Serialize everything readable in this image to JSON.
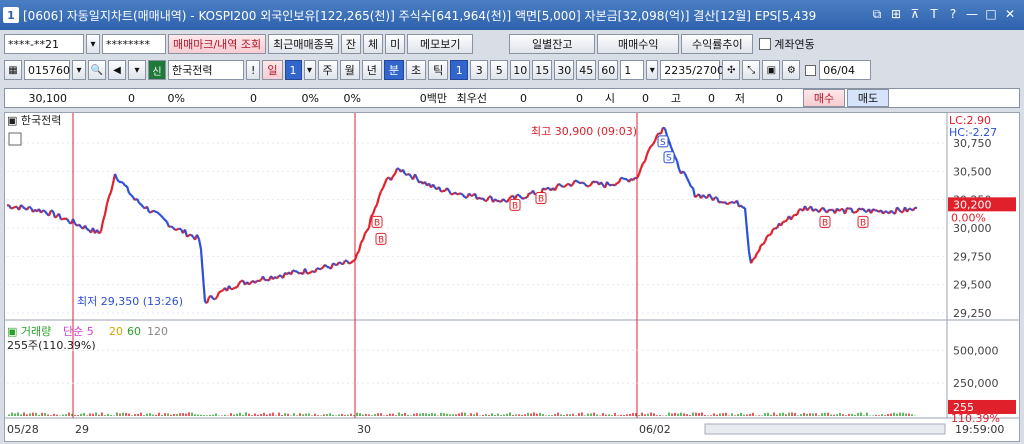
{
  "window": {
    "num": "1",
    "title": "[0606] 자동일지차트(매매내역) - KOSPI200 외국인보유[122,265(천)] 주식수[641,964(천)] 액면[5,000] 자본금[32,098(억)] 결산[12월] EPS[5,439"
  },
  "toolbar1": {
    "account": "****-**21",
    "password": "********",
    "btn_query": "매매마크/내역 조회",
    "btn_recent": "최근매매종목",
    "btn_jan": "잔",
    "btn_che": "체",
    "btn_mi": "미",
    "btn_memo": "메모보기",
    "btn_daily": "일별잔고",
    "btn_profit": "매매수익",
    "btn_ratio": "수익률추이",
    "chk_account": "계좌연동"
  },
  "toolbar2": {
    "code": "015760",
    "badge": "신",
    "name": "한국전력",
    "excl": "!",
    "period_il": "일",
    "period_num": "1",
    "ju": "주",
    "wol": "월",
    "nyeon": "년",
    "bun": "분",
    "cho": "초",
    "tik": "틱",
    "intervals": [
      "1",
      "3",
      "5",
      "10",
      "15",
      "30",
      "45",
      "60"
    ],
    "count": "1",
    "range": "2235/2700",
    "date": "06/04"
  },
  "statusbar": {
    "price": "30,100",
    "v1": "0",
    "p1": "0%",
    "v2": "0",
    "p2": "0%",
    "p3": "0%",
    "unit": "0백만",
    "best": "최우선",
    "b1": "0",
    "b2": "0",
    "si": "시",
    "si_v": "0",
    "go": "고",
    "go_v": "0",
    "jeo": "저",
    "jeo_v": "0",
    "buy": "매수",
    "sell": "매도"
  },
  "chart": {
    "stock_label": "한국전력",
    "lc": "LC:2.90",
    "hc": "HC:-2.27",
    "high_annot": "최고 30,900 (09:03)",
    "low_annot": "최저 29,350 (13:26)",
    "current_price": "30,200",
    "current_pct": "0.00%",
    "yticks": [
      "30,750",
      "30,500",
      "30,250",
      "30,000",
      "29,750",
      "29,500",
      "29,250"
    ],
    "vol_legend": [
      "거래량",
      "단순",
      "5",
      "20",
      "60",
      "120"
    ],
    "vol_info": "255주(110.39%)",
    "vol_yticks": [
      "500,000",
      "250,000"
    ],
    "vol_current": "255",
    "vol_pct": "110.39%",
    "xlabels": [
      "05/28",
      "29",
      "30",
      "06/02"
    ],
    "time": "19:59:00",
    "colors": {
      "up": "#e0202a",
      "down": "#2b4fd8",
      "ma5": "#cc44cc",
      "ma20": "#e0a000",
      "ma60": "#2aa02a",
      "ma120": "#888888"
    }
  }
}
